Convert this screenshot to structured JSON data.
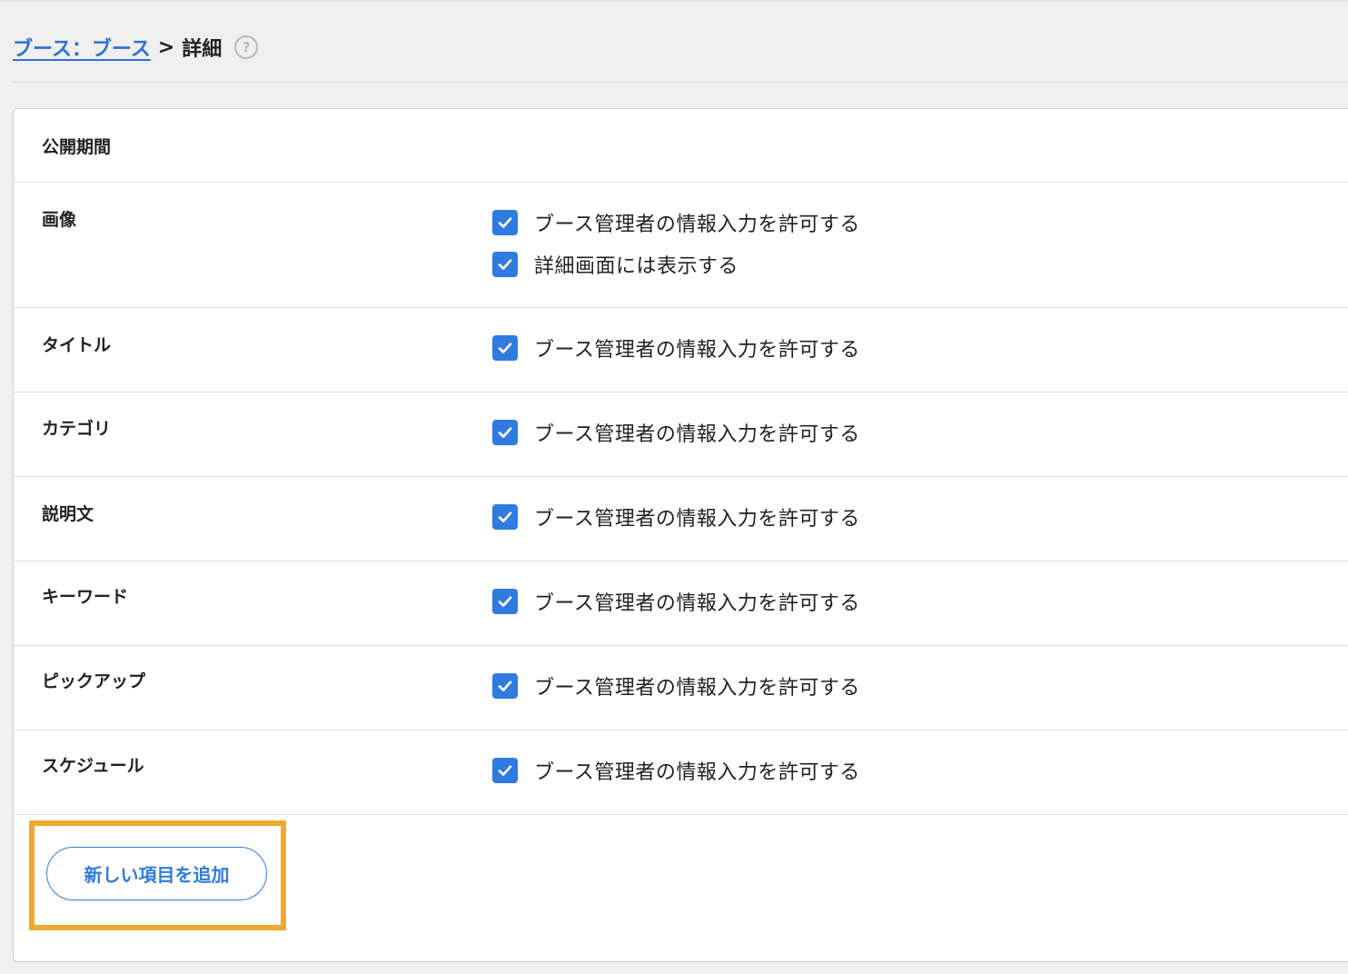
{
  "breadcrumb": {
    "link_label": "ブース：ブース ",
    "separator": ">",
    "current": "詳細",
    "help_glyph": "?"
  },
  "panel": {
    "header_label": "公開期間",
    "rows": [
      {
        "label": "画像",
        "options": [
          {
            "text": "ブース管理者の情報入力を許可する",
            "checked": true
          },
          {
            "text": "詳細画面には表示する",
            "checked": true
          }
        ]
      },
      {
        "label": "タイトル",
        "options": [
          {
            "text": "ブース管理者の情報入力を許可する",
            "checked": true
          }
        ]
      },
      {
        "label": "カテゴリ",
        "options": [
          {
            "text": "ブース管理者の情報入力を許可する",
            "checked": true
          }
        ]
      },
      {
        "label": "説明文",
        "options": [
          {
            "text": "ブース管理者の情報入力を許可する",
            "checked": true
          }
        ]
      },
      {
        "label": "キーワード",
        "options": [
          {
            "text": "ブース管理者の情報入力を許可する",
            "checked": true
          }
        ]
      },
      {
        "label": "ピックアップ",
        "options": [
          {
            "text": "ブース管理者の情報入力を許可する",
            "checked": true
          }
        ]
      },
      {
        "label": "スケジュール",
        "options": [
          {
            "text": "ブース管理者の情報入力を許可する",
            "checked": true
          }
        ]
      }
    ],
    "add_button_label": "新しい項目を追加"
  },
  "colors": {
    "accent": "#2f7be0",
    "highlight": "#f0a82e",
    "page_background": "#efefef"
  },
  "icons": {
    "checkbox": "checkmark-icon",
    "help": "question-circle-icon"
  }
}
